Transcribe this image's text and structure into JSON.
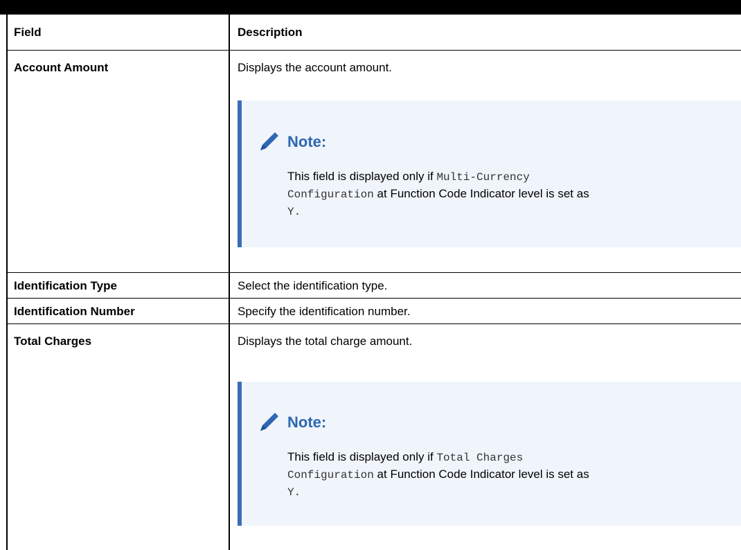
{
  "table": {
    "headers": {
      "field": "Field",
      "description": "Description"
    },
    "rows": [
      {
        "field": "Account Amount",
        "description": "Displays the account amount."
      },
      {
        "field": "Identification Type",
        "description": "Select the identification type."
      },
      {
        "field": "Identification Number",
        "description": "Specify the identification number."
      },
      {
        "field": "Total Charges",
        "description": "Displays the total charge amount."
      }
    ]
  },
  "notes": [
    {
      "title": "Note:",
      "text_before": "This field is displayed only if ",
      "code_1": "Multi-Currency",
      "code_2": "Configuration",
      "text_after": " at Function Code Indicator level is set as",
      "code_value": "Y."
    },
    {
      "title": "Note:",
      "text_before": "This field is displayed only if ",
      "code_1": "Total Charges",
      "code_2": "Configuration",
      "text_after": " at Function Code Indicator level is set as",
      "code_value": "Y."
    }
  ],
  "colors": {
    "note_background": "#f0f5fc",
    "note_accent": "#3a6db5",
    "note_title": "#2e66b2",
    "pencil_icon": "#2e66b2"
  },
  "icons": {
    "note_icon": "pencil-icon"
  }
}
